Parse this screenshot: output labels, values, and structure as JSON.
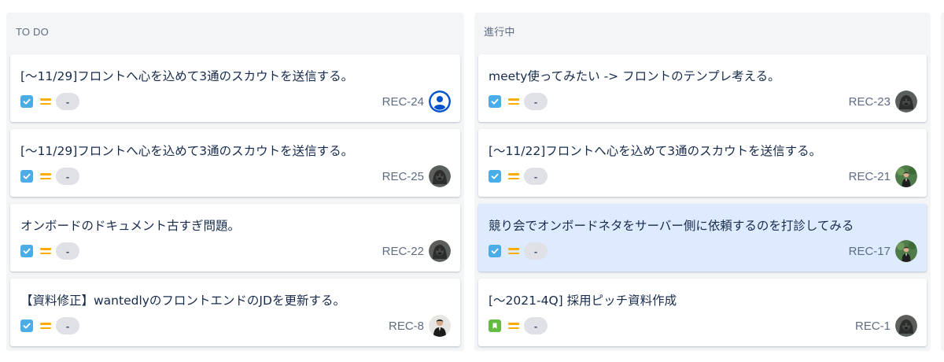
{
  "columns": [
    {
      "title": "TO DO",
      "cards": [
        {
          "summary": "[〜11/29]フロントへ心を込めて3通のスカウトを送信する。",
          "key": "REC-24",
          "type": "task-icon",
          "priority": "medium-priority-icon",
          "badge": "-",
          "avatar": "default-user-avatar"
        },
        {
          "summary": "[〜11/29]フロントへ心を込めて3通のスカウトを送信する。",
          "key": "REC-25",
          "type": "task-icon",
          "priority": "medium-priority-icon",
          "badge": "-",
          "avatar": "gorilla-avatar"
        },
        {
          "summary": "オンボードのドキュメント古すぎ問題。",
          "key": "REC-22",
          "type": "task-icon",
          "priority": "medium-priority-icon",
          "badge": "-",
          "avatar": "gorilla-avatar"
        },
        {
          "summary": "【資料修正】wantedlyのフロントエンドのJDを更新する。",
          "key": "REC-8",
          "type": "task-icon",
          "priority": "medium-priority-icon",
          "badge": "-",
          "avatar": "person-avatar"
        }
      ]
    },
    {
      "title": "進行中",
      "cards": [
        {
          "summary": "meety使ってみたい -> フロントのテンプレ考える。",
          "key": "REC-23",
          "type": "task-icon",
          "priority": "medium-priority-icon",
          "badge": "-",
          "avatar": "gorilla-avatar"
        },
        {
          "summary": "[〜11/22]フロントへ心を込めて3通のスカウトを送信する。",
          "key": "REC-21",
          "type": "task-icon",
          "priority": "medium-priority-icon",
          "badge": "-",
          "avatar": "outdoor-person-avatar"
        },
        {
          "summary": "競り会でオンボードネタをサーバー側に依頼するのを打診してみる",
          "key": "REC-17",
          "type": "task-icon",
          "priority": "medium-priority-icon",
          "badge": "-",
          "avatar": "outdoor-person-avatar",
          "highlighted": true
        },
        {
          "summary": "[〜2021-4Q] 採用ピッチ資料作成",
          "key": "REC-1",
          "type": "story-icon",
          "priority": "medium-priority-icon",
          "badge": "-",
          "avatar": "gorilla-avatar"
        }
      ]
    }
  ],
  "colors": {
    "task": "#4bade8",
    "story": "#65ba43",
    "priority_medium": "#ffab00",
    "highlight": "#deebff"
  }
}
